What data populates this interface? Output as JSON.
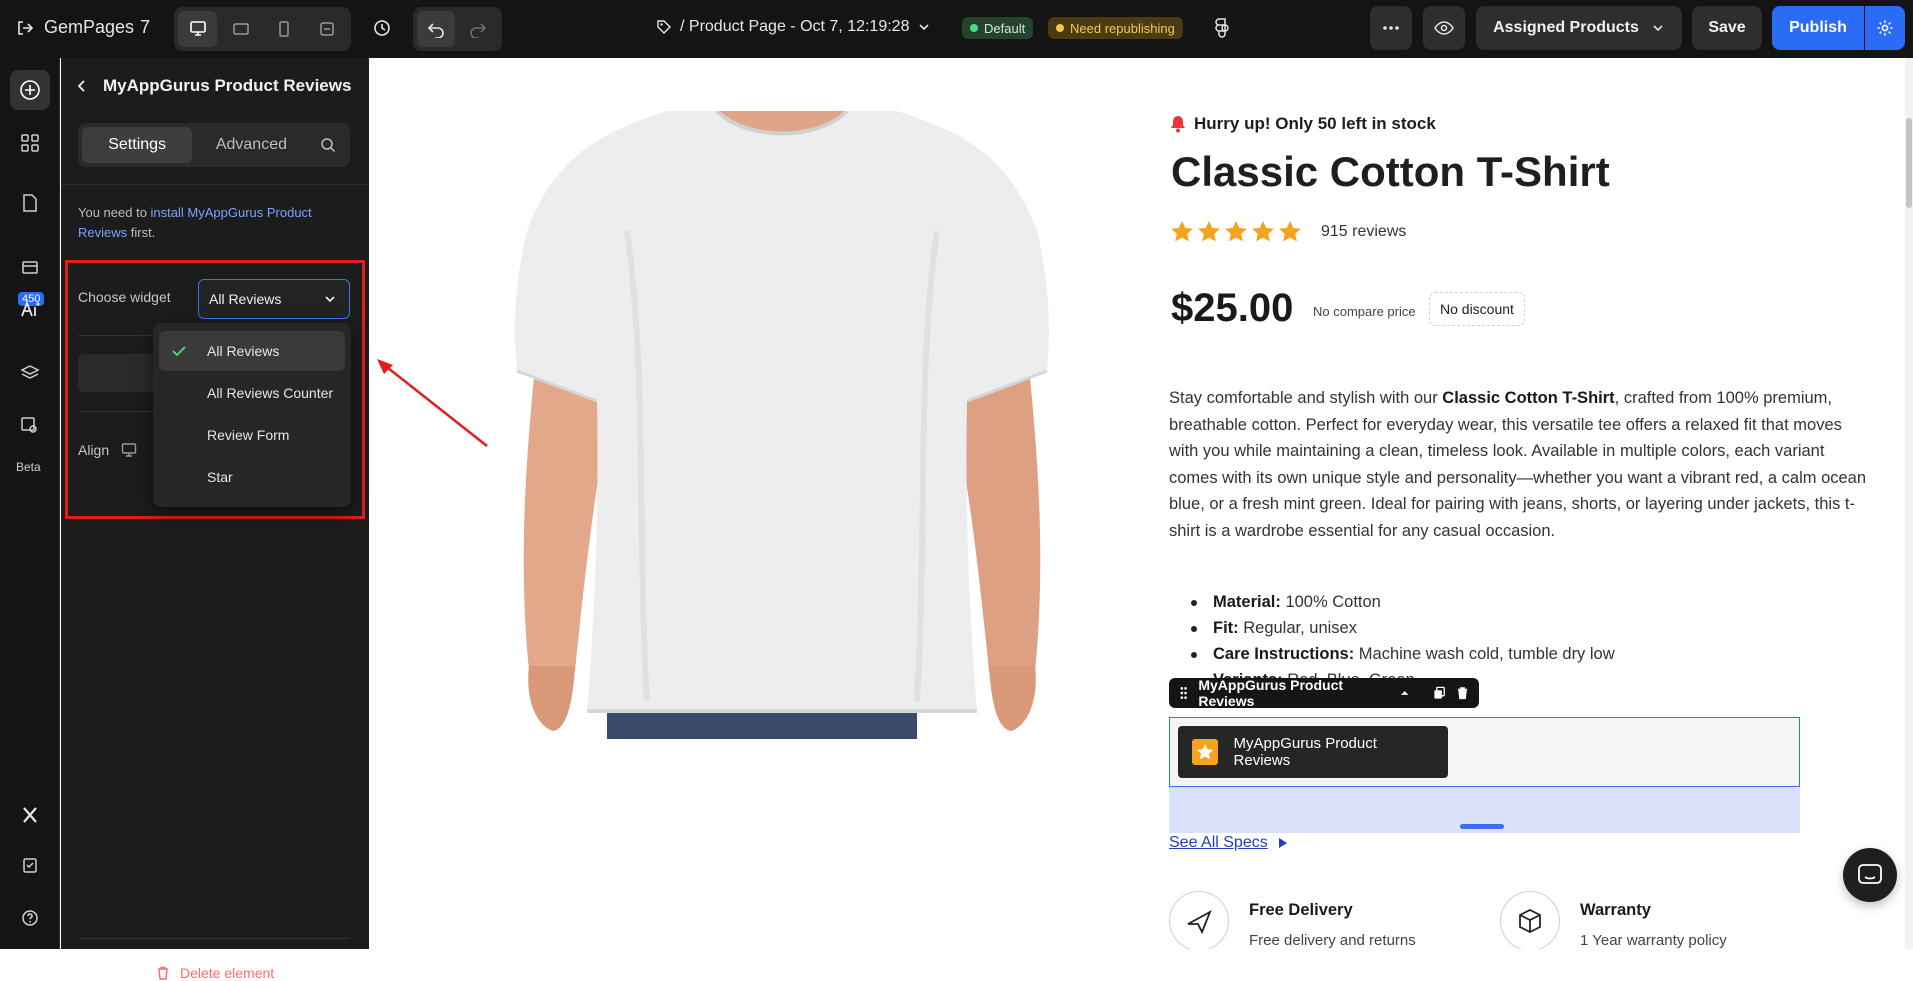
{
  "topbar": {
    "logo_text": "GemPages",
    "version": "7",
    "page_title": "/ Product Page - Oct 7, 12:19:28",
    "badge_default": "Default",
    "badge_need_republish": "Need republishing",
    "assigned_products": "Assigned Products",
    "save_label": "Save",
    "publish_label": "Publish"
  },
  "rail": {
    "count_badge": "450",
    "beta_label": "Beta"
  },
  "panel": {
    "title": "MyAppGurus Product Reviews",
    "tab_settings": "Settings",
    "tab_advanced": "Advanced",
    "notice_prefix": "You need to ",
    "notice_link": "install MyAppGurus Product Reviews",
    "notice_suffix": " first.",
    "choose_widget_label": "Choose widget",
    "selected_widget": "All Reviews",
    "align_label": "Align",
    "widget_options": [
      "All Reviews",
      "All Reviews Counter",
      "Review Form",
      "Star"
    ],
    "delete_label": "Delete element"
  },
  "product": {
    "stock_notice": "Hurry up! Only 50 left in stock",
    "title": "Classic Cotton T-Shirt",
    "rating": 5,
    "reviews": "915 reviews",
    "price": "$25.00",
    "compare_price": "No compare price",
    "discount": "No discount",
    "desc_1": "Stay comfortable and stylish with our ",
    "desc_bold": "Classic Cotton T-Shirt",
    "desc_2": ", crafted from 100% premium, breathable cotton. Perfect for everyday wear, this versatile tee offers a relaxed fit that moves with you while maintaining a clean, timeless look. Available in multiple colors, each variant comes with its own unique style and personality—whether you want a vibrant red, a calm ocean blue, or a fresh mint green. Ideal for pairing with jeans, shorts, or layering under jackets, this t-shirt is a wardrobe essential for any casual occasion.",
    "specs": [
      {
        "key": "Material:",
        "value": " 100% Cotton"
      },
      {
        "key": "Fit:",
        "value": " Regular, unisex"
      },
      {
        "key": "Care Instructions:",
        "value": " Machine wash cold, tumble dry low"
      },
      {
        "key": "Variants:",
        "value": " Red, Blue, Green"
      }
    ],
    "element_toolbar_label": "MyAppGurus Product Reviews",
    "widget_chip_label": "MyAppGurus Product Reviews",
    "see_all_specs": "See All Specs",
    "feature_1_title": "Free Delivery",
    "feature_1_sub": "Free delivery and returns",
    "feature_2_title": "Warranty",
    "feature_2_sub": "1 Year warranty policy"
  },
  "colors": {
    "accent": "#2b6cf6",
    "annotation_red": "#e11d1d",
    "star_gold": "#f4a31c"
  }
}
